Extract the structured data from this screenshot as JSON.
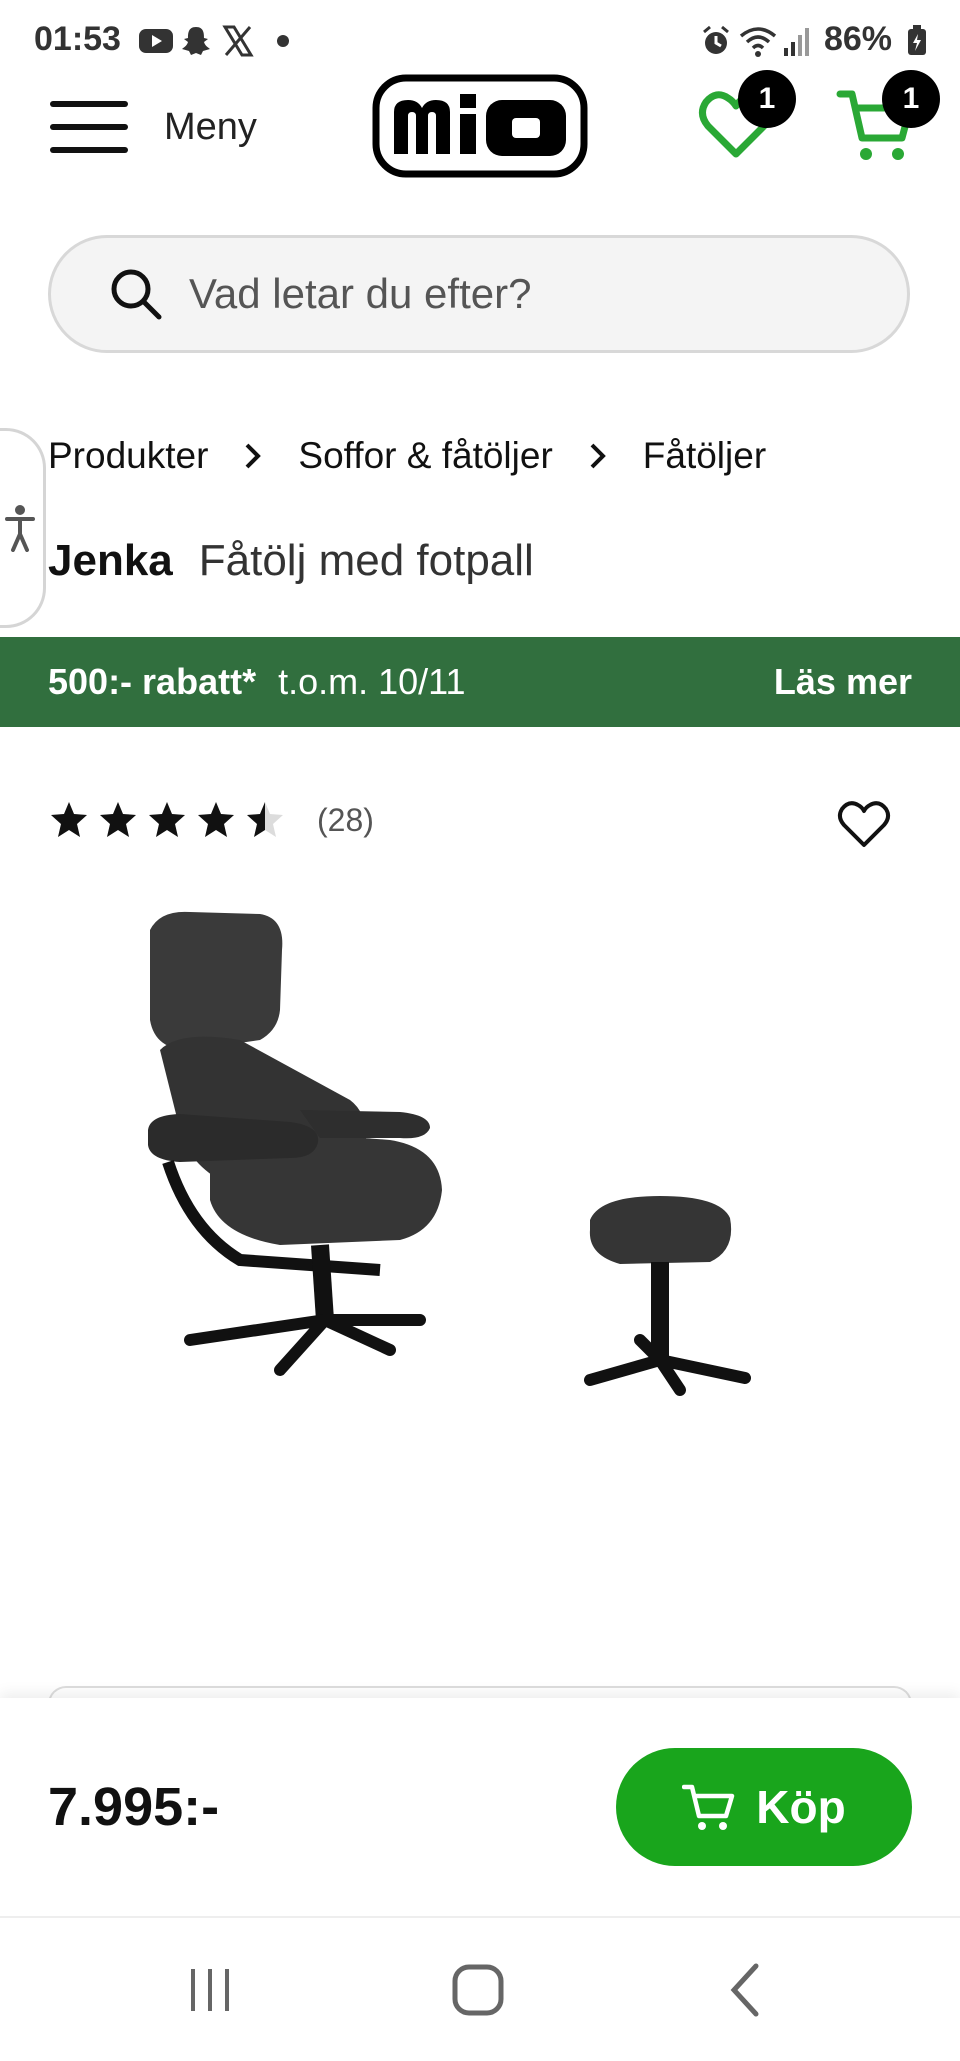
{
  "status_bar": {
    "time": "01:53",
    "battery": "86%",
    "icons": [
      "youtube-icon",
      "snapchat-icon",
      "x-icon",
      "dot-icon",
      "alarm-icon",
      "wifi-icon",
      "signal-icon",
      "battery-icon"
    ]
  },
  "header": {
    "menu_label": "Meny",
    "logo_text": "mio",
    "wishlist_count": "1",
    "cart_count": "1"
  },
  "search": {
    "placeholder": "Vad letar du efter?"
  },
  "breadcrumb": {
    "items": [
      "Produkter",
      "Soffor & fåtöljer",
      "Fåtöljer"
    ]
  },
  "product": {
    "brand": "Jenka",
    "name": "Fåtölj med fotpall",
    "rating_value": 4.5,
    "rating_max": 5,
    "review_count": "(28)",
    "price": "7.995:-"
  },
  "promo": {
    "amount": "500:- rabatt*",
    "date": "t.o.m. 10/11",
    "link": "Läs mer"
  },
  "buy": {
    "label": "Köp"
  },
  "colors": {
    "accent_green": "#19a51c",
    "promo_green": "#316f3e",
    "icon_green": "#2aa835"
  }
}
